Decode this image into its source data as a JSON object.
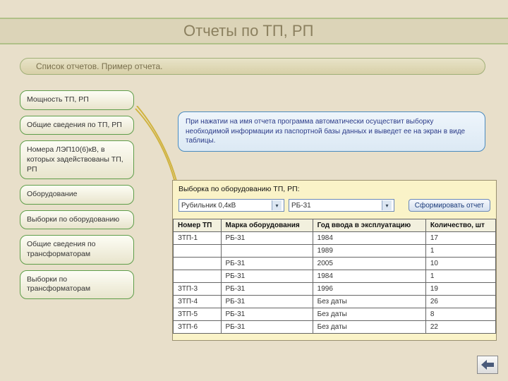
{
  "header": {
    "title": "Отчеты по ТП, РП"
  },
  "subheader": "Список отчетов. Пример отчета.",
  "sidebar": {
    "items": [
      {
        "label": "Мощность ТП, РП"
      },
      {
        "label": "Общие сведения по ТП, РП"
      },
      {
        "label": "Номера ЛЭП10(6)кВ, в которых задействованы ТП, РП"
      },
      {
        "label": "Оборудование"
      },
      {
        "label": "Выборки по оборудованию"
      },
      {
        "label": "Общие сведения по трансформаторам"
      },
      {
        "label": "Выборки по трансформаторам"
      }
    ]
  },
  "info": "При нажатии на имя отчета программа автоматически осуществит выборку необходимой информации из паспортной базы данных и выведет ее на экран в виде таблицы.",
  "report": {
    "title": "Выборка по оборудованию ТП, РП:",
    "dropdown1": "Рубильник 0,4кВ",
    "dropdown2": "РБ-31",
    "button": "Сформировать отчет",
    "columns": [
      "Номер ТП",
      "Марка оборудования",
      "Год ввода в эксплуатацию",
      "Количество, шт"
    ],
    "rows": [
      [
        "ЗТП-1",
        "РБ-31",
        "1984",
        "17"
      ],
      [
        "",
        "",
        "1989",
        "1"
      ],
      [
        "",
        "РБ-31",
        "2005",
        "10"
      ],
      [
        "",
        "РБ-31",
        "1984",
        "1"
      ],
      [
        "ЗТП-3",
        "РБ-31",
        "1996",
        "19"
      ],
      [
        "ЗТП-4",
        "РБ-31",
        "Без даты",
        "26"
      ],
      [
        "ЗТП-5",
        "РБ-31",
        "Без даты",
        "8"
      ],
      [
        "ЗТП-6",
        "РБ-31",
        "Без даты",
        "22"
      ]
    ]
  },
  "nav": {
    "back": "Назад"
  }
}
